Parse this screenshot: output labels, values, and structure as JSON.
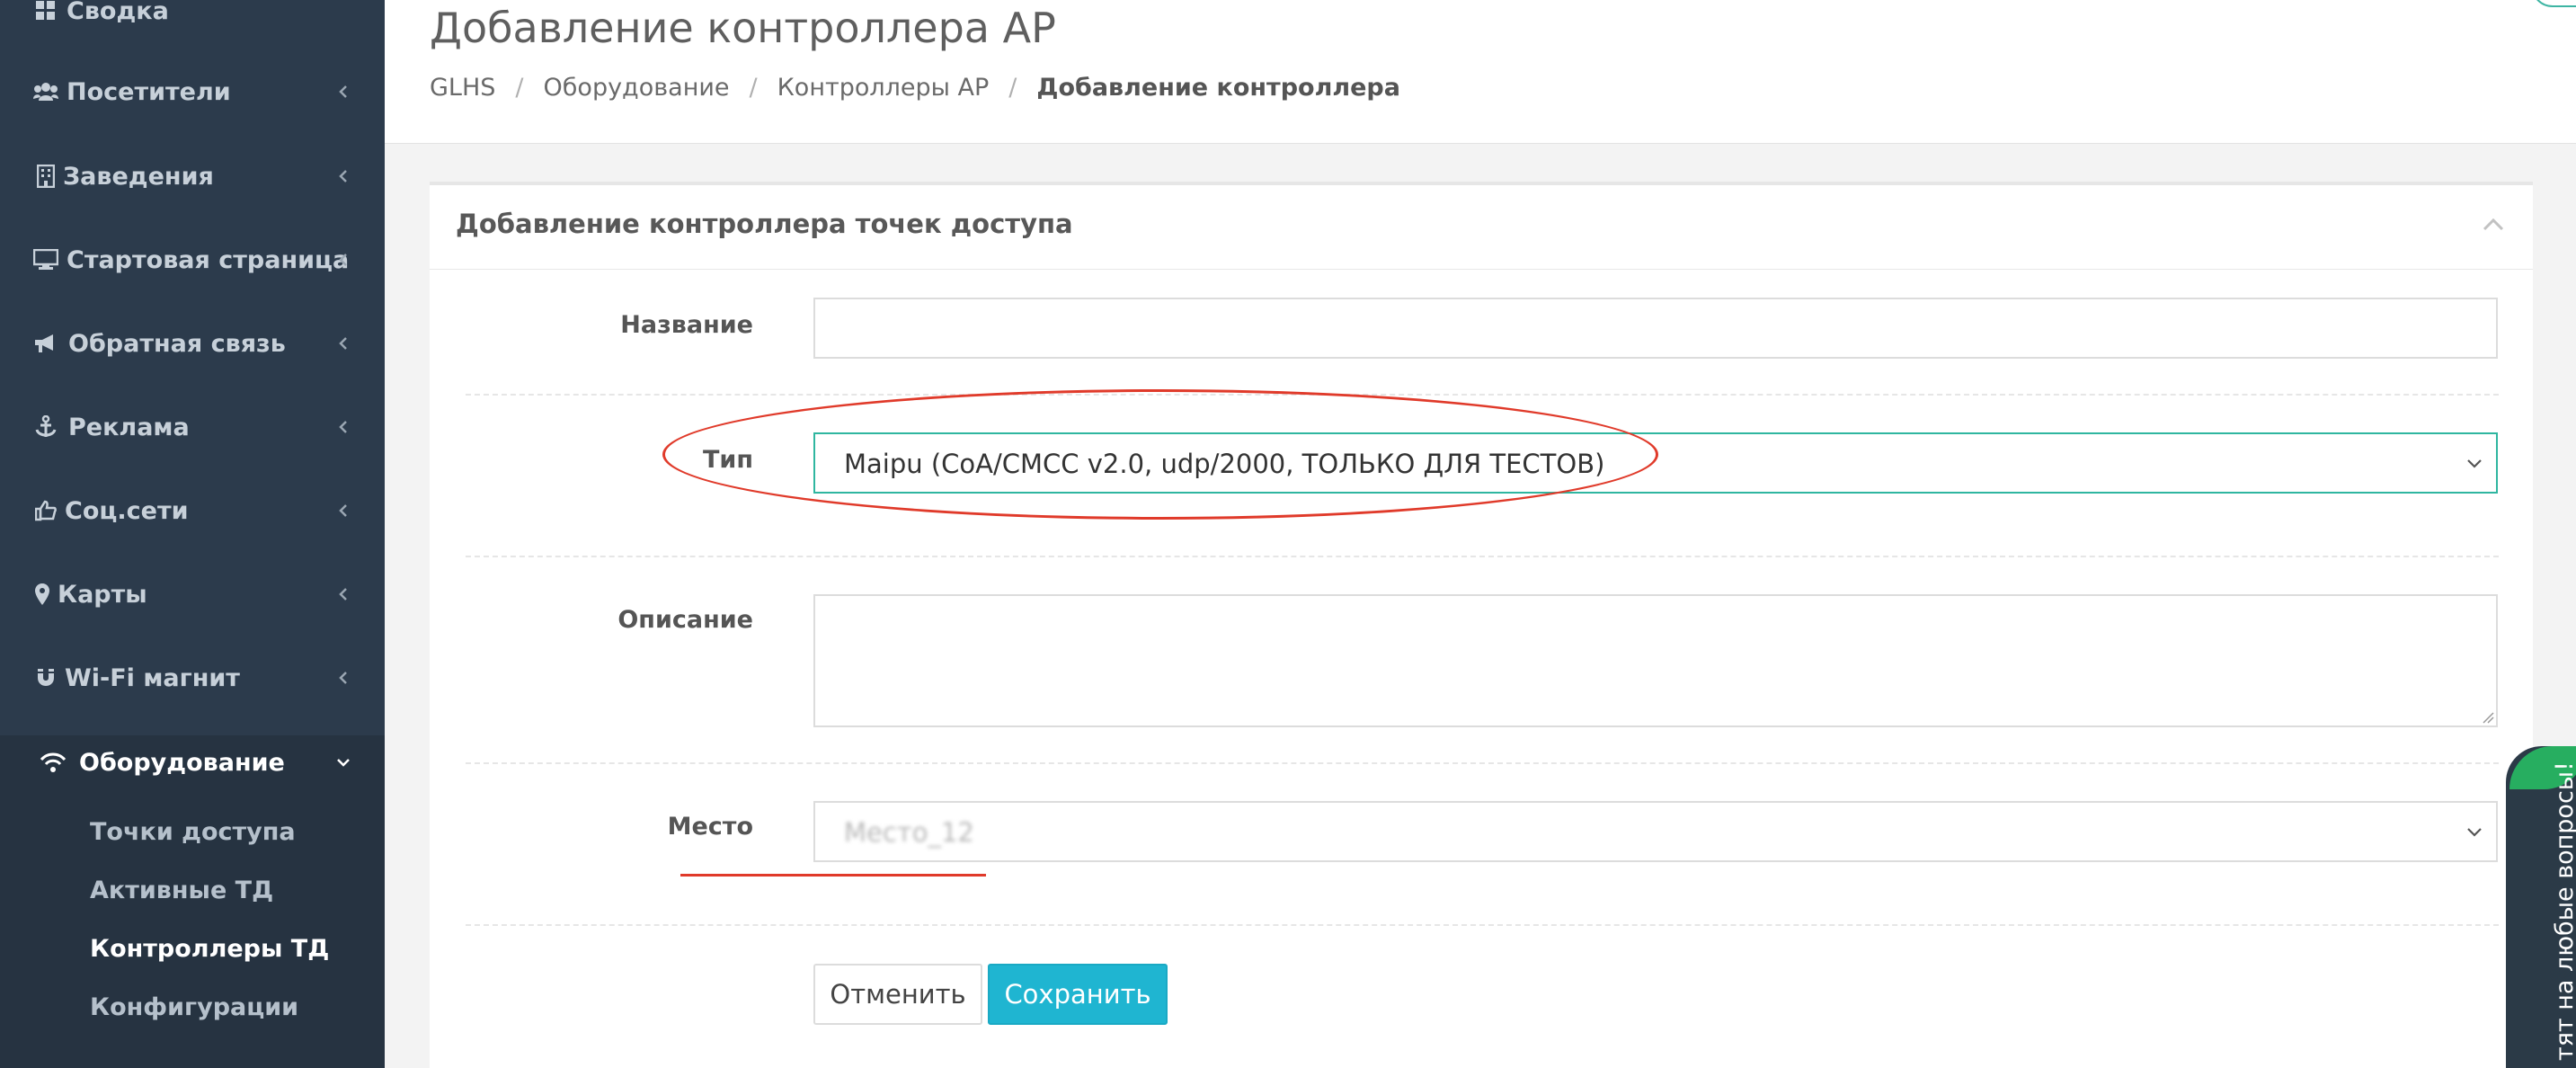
{
  "sidebar": {
    "items": [
      {
        "label": "Сводка",
        "icon": "dashboard-icon"
      },
      {
        "label": "Посетители",
        "icon": "users-icon"
      },
      {
        "label": "Заведения",
        "icon": "building-icon"
      },
      {
        "label": "Стартовая страница",
        "icon": "desktop-icon"
      },
      {
        "label": "Обратная связь",
        "icon": "megaphone-icon"
      },
      {
        "label": "Реклама",
        "icon": "anchor-icon"
      },
      {
        "label": "Соц.сети",
        "icon": "thumbs-up-icon"
      },
      {
        "label": "Карты",
        "icon": "map-marker-icon"
      },
      {
        "label": "Wi-Fi магнит",
        "icon": "magnet-icon"
      },
      {
        "label": "Оборудование",
        "icon": "wifi-icon",
        "expanded": true
      }
    ],
    "subitems": [
      {
        "label": "Точки доступа"
      },
      {
        "label": "Активные ТД"
      },
      {
        "label": "Контроллеры ТД",
        "current": true
      },
      {
        "label": "Конфигурации"
      }
    ]
  },
  "header": {
    "title": "Добавление контроллера AP",
    "breadcrumb": [
      "GLHS",
      "Оборудование",
      "Контроллеры AP",
      "Добавление контроллера"
    ],
    "separator": "/"
  },
  "panel": {
    "title": "Добавление контроллера точек доступа"
  },
  "form": {
    "name": {
      "label": "Название",
      "value": ""
    },
    "type": {
      "label": "Тип",
      "value": "Maipu (CoA/CMCC v2.0, udp/2000, ТОЛЬКО ДЛЯ ТЕСТОВ)"
    },
    "description": {
      "label": "Описание",
      "value": ""
    },
    "place": {
      "label": "Место",
      "value": "Место_12"
    },
    "cancel_label": "Отменить",
    "save_label": "Сохранить"
  },
  "chat_widget": {
    "label": "тят на любые вопросы!"
  },
  "colors": {
    "sidebar_bg": "#2c3b4c",
    "accent_teal": "#2fb6a0",
    "save_button": "#1fb5d1",
    "annotation_red": "#e03a2a"
  }
}
